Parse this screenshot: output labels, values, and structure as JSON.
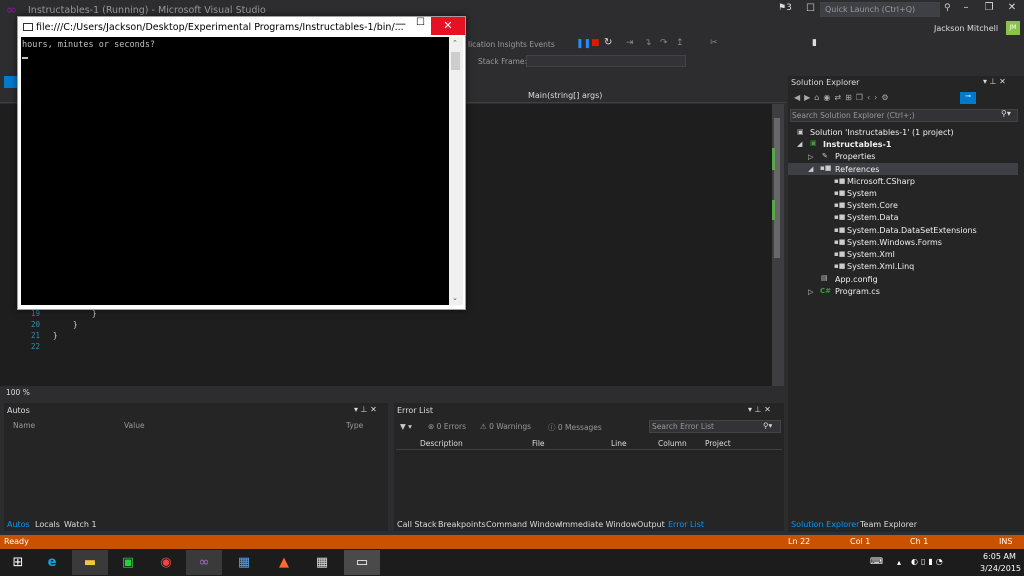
{
  "titlebar": {
    "title": "Instructables-1 (Running) - Microsoft Visual Studio",
    "notification_count": "3",
    "quick_launch_placeholder": "Quick Launch (Ctrl+Q)",
    "user_name": "Jackson Mitchell",
    "user_initials": "JM"
  },
  "toolbar": {
    "app_insights_label": "lication Insights Events",
    "stack_frame_label": "Stack Frame:"
  },
  "editor": {
    "method_dropdown": "Main(string[] args)",
    "lines": [
      {
        "num": "19",
        "code": "}"
      },
      {
        "num": "20",
        "code": "}"
      },
      {
        "num": "21",
        "code": "}"
      },
      {
        "num": "22",
        "code": ""
      }
    ],
    "zoom": "100 %"
  },
  "console": {
    "title": "file:///C:/Users/Jackson/Desktop/Experimental Programs/Instructables-1/bin/...",
    "output": "hours, minutes or seconds?"
  },
  "autos": {
    "title": "Autos",
    "columns": [
      "Name",
      "Value",
      "Type"
    ],
    "tabs": [
      "Autos",
      "Locals",
      "Watch 1"
    ]
  },
  "error_list": {
    "title": "Error List",
    "errors": "0 Errors",
    "warnings": "0 Warnings",
    "messages": "0 Messages",
    "search_placeholder": "Search Error List",
    "columns": [
      "Description",
      "File",
      "Line",
      "Column",
      "Project"
    ],
    "tabs": [
      "Call Stack",
      "Breakpoints",
      "Command Window",
      "Immediate Window",
      "Output",
      "Error List"
    ]
  },
  "solution_explorer": {
    "title": "Solution Explorer",
    "search_placeholder": "Search Solution Explorer (Ctrl+;)",
    "solution": "Solution 'Instructables-1' (1 project)",
    "project": "Instructables-1",
    "properties": "Properties",
    "references": "References",
    "reference_items": [
      "Microsoft.CSharp",
      "System",
      "System.Core",
      "System.Data",
      "System.Data.DataSetExtensions",
      "System.Windows.Forms",
      "System.Xml",
      "System.Xml.Linq"
    ],
    "app_config": "App.config",
    "program": "Program.cs",
    "tabs": [
      "Solution Explorer",
      "Team Explorer"
    ]
  },
  "statusbar": {
    "status": "Ready",
    "line": "Ln 22",
    "col": "Col 1",
    "ch": "Ch 1",
    "mode": "INS"
  },
  "taskbar": {
    "time": "6:05 AM",
    "date": "3/24/2015"
  },
  "colors": {
    "status_bar": "#ca5100",
    "accent": "#007acc",
    "close_red": "#e81123"
  }
}
